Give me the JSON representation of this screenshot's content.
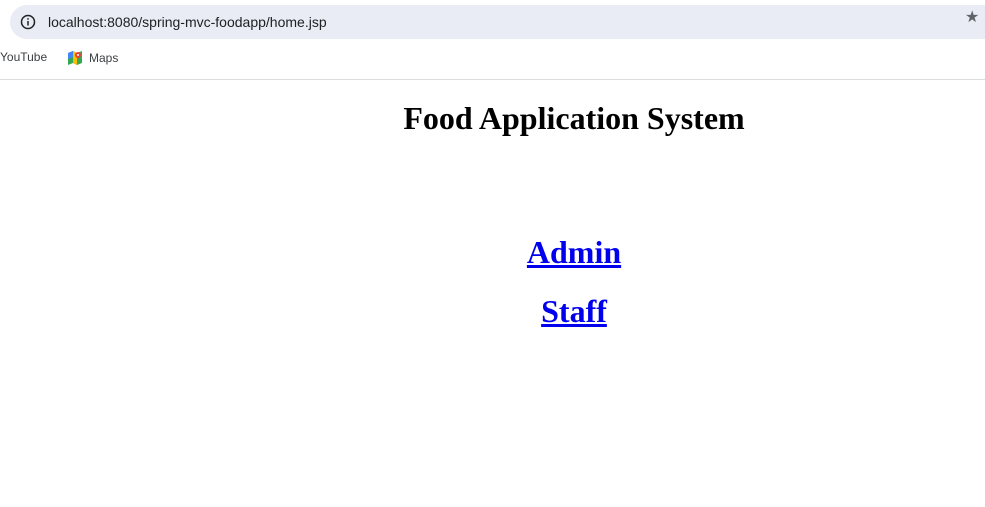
{
  "browser": {
    "url": "localhost:8080/spring-mvc-foodapp/home.jsp",
    "bookmarks": [
      {
        "label": "YouTube"
      },
      {
        "label": "Maps"
      }
    ]
  },
  "page": {
    "title": "Food Application System",
    "links": [
      {
        "label": "Admin"
      },
      {
        "label": "Staff"
      }
    ]
  },
  "colors": {
    "link": "#0000ee",
    "address_bar": "#e9ecf4"
  }
}
